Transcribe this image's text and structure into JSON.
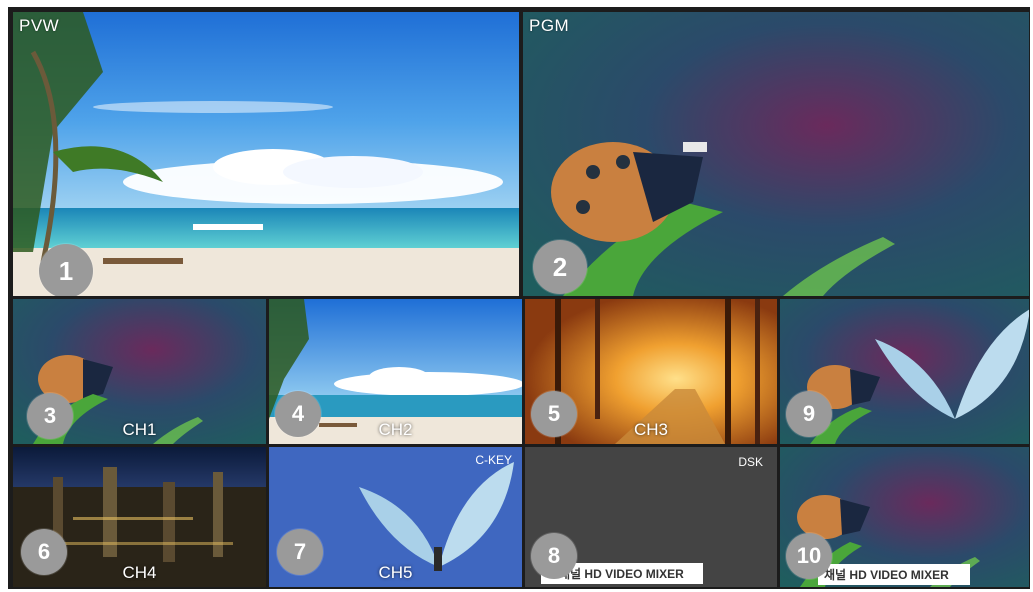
{
  "multiview": {
    "pvw": {
      "label": "PVW",
      "number": "1"
    },
    "pgm": {
      "label": "PGM",
      "number": "2"
    },
    "ch1": {
      "label": "CH1",
      "number": "3",
      "status_color": "#e01b1b"
    },
    "ch2": {
      "label": "CH2",
      "number": "4",
      "status_color": "#27c44a"
    },
    "ch3": {
      "label": "CH3",
      "number": "5"
    },
    "ch4": {
      "label": "CH4",
      "number": "6"
    },
    "ch5": {
      "label": "CH5",
      "number": "7",
      "key_label": "C-KEY"
    },
    "dsk": {
      "label": "DSK",
      "number": "8",
      "overlay_text": "～채널 HD VIDEO MIXER"
    },
    "ckey_preview": {
      "number": "9"
    },
    "dsk_preview": {
      "number": "10",
      "overlay_text": "채널 HD VIDEO MIXER"
    }
  },
  "icons": {
    "beach": "beach-scene",
    "ladybug": "ladybug-scene",
    "forest": "autumn-forest-scene",
    "city": "night-city-scene",
    "butterfly": "butterfly-scene"
  }
}
